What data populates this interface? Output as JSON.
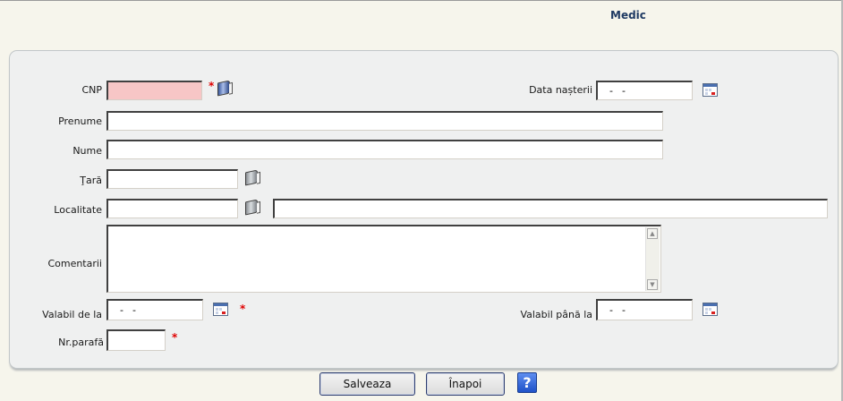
{
  "header": {
    "title": "Medic"
  },
  "form": {
    "cnp": {
      "label": "CNP",
      "value": "",
      "required_mark": "*",
      "lookup_icon": "book-lookup-icon"
    },
    "data_nasterii": {
      "label": "Data nașterii",
      "value": "  -  -",
      "picker_icon": "calendar-icon"
    },
    "prenume": {
      "label": "Prenume",
      "value": ""
    },
    "nume": {
      "label": "Nume",
      "value": ""
    },
    "tara": {
      "label": "Ţară",
      "value": "",
      "lookup_icon": "book-lookup-icon"
    },
    "localitate": {
      "label": "Localitate",
      "value": "",
      "value_extra": "",
      "lookup_icon": "book-lookup-icon"
    },
    "comentarii": {
      "label": "Comentarii",
      "value": ""
    },
    "valabil_de_la": {
      "label": "Valabil de la",
      "value": "  -  -",
      "required_mark": "*",
      "picker_icon": "calendar-icon"
    },
    "valabil_pana_la": {
      "label": "Valabil până la",
      "value": "  -  -",
      "picker_icon": "calendar-icon"
    },
    "nr_parafa": {
      "label": "Nr.parafă",
      "value": "",
      "required_mark": "*"
    }
  },
  "buttons": {
    "save_label": "Salveaza",
    "back_label": "Înapoi",
    "help_label": "?"
  },
  "colors": {
    "required_field_bg": "#f7c6c6",
    "title_color": "#1f3a63",
    "required_mark": "#e00000",
    "panel_bg": "#eff0f0"
  }
}
